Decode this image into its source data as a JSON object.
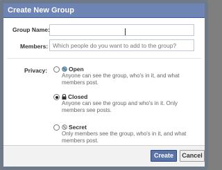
{
  "dialog": {
    "title": "Create New Group",
    "group_name": {
      "label": "Group Name:",
      "value": ""
    },
    "members": {
      "label": "Members:",
      "placeholder": "Which people do you want to add to the group?"
    },
    "privacy": {
      "label": "Privacy:",
      "selected": "Closed",
      "options": [
        {
          "title": "Open",
          "icon": "globe-icon",
          "description": "Anyone can see the group, who's in it, and what members post."
        },
        {
          "title": "Closed",
          "icon": "lock-icon",
          "description": "Anyone can see the group and who's in it. Only members see posts."
        },
        {
          "title": "Secret",
          "icon": "secret-icon",
          "description": "Only members see the group, who's in it, and what members post."
        }
      ]
    },
    "buttons": {
      "create": "Create",
      "cancel": "Cancel"
    },
    "colors": {
      "header": "#6d84b4",
      "button_primary": "#5b74a8"
    }
  }
}
